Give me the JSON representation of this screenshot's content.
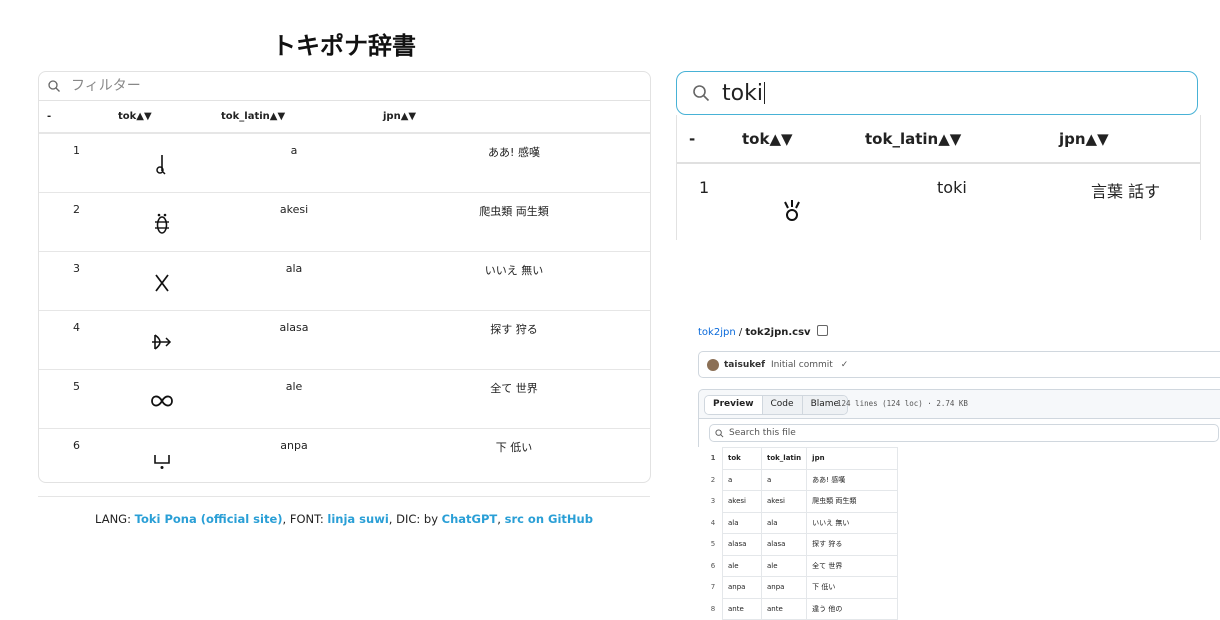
{
  "title": "トキポナ辞書",
  "filter": {
    "placeholder": "フィルター"
  },
  "columns": {
    "num": "-",
    "tok": "tok▲▼",
    "tok_latin": "tok_latin▲▼",
    "jpn": "jpn▲▼"
  },
  "rows": [
    {
      "num": "1",
      "latin": "a",
      "jpn": "ああ! 感嘆",
      "glyph": "a-glyph"
    },
    {
      "num": "2",
      "latin": "akesi",
      "jpn": "爬虫類 両生類",
      "glyph": "akesi-glyph"
    },
    {
      "num": "3",
      "latin": "ala",
      "jpn": "いいえ 無い",
      "glyph": "ala-glyph"
    },
    {
      "num": "4",
      "latin": "alasa",
      "jpn": "探す 狩る",
      "glyph": "alasa-glyph"
    },
    {
      "num": "5",
      "latin": "ale",
      "jpn": "全て 世界",
      "glyph": "ale-glyph"
    },
    {
      "num": "6",
      "latin": "anpa",
      "jpn": "下 低い",
      "glyph": "anpa-glyph"
    }
  ],
  "footer": {
    "lang_label": "LANG: ",
    "lang_link": "Toki Pona (official site)",
    "font_label": ", FONT: ",
    "font_link": "linja suwi",
    "dic_label": ", DIC: by ",
    "dic_link": "ChatGPT",
    "sep": ", ",
    "src_link": "src on GitHub"
  },
  "zoom": {
    "search_value": "toki",
    "row": {
      "num": "1",
      "latin": "toki",
      "jpn": "言葉 話す",
      "glyph": "toki-glyph"
    }
  },
  "github": {
    "repo": "tok2jpn",
    "sep": " / ",
    "file": "tok2jpn.csv",
    "author": "taisukef",
    "commit_msg": "Initial commit",
    "check": "✓",
    "tabs": [
      "Preview",
      "Code",
      "Blame"
    ],
    "meta": "124 lines (124 loc) · 2.74 KB",
    "search_placeholder": "Search this file",
    "csv_rows": [
      [
        "1",
        "tok",
        "tok_latin",
        "jpn"
      ],
      [
        "2",
        "a",
        "a",
        "ああ! 感嘆"
      ],
      [
        "3",
        "akesi",
        "akesi",
        "爬虫類 両生類"
      ],
      [
        "4",
        "ala",
        "ala",
        "いいえ 無い"
      ],
      [
        "5",
        "alasa",
        "alasa",
        "探す 狩る"
      ],
      [
        "6",
        "ale",
        "ale",
        "全て 世界"
      ],
      [
        "7",
        "anpa",
        "anpa",
        "下 低い"
      ],
      [
        "8",
        "ante",
        "ante",
        "違う 他の"
      ]
    ]
  },
  "colors": {
    "accent": "#2a9fd6",
    "focus_border": "#48b2d6",
    "github_link": "#0969da"
  }
}
